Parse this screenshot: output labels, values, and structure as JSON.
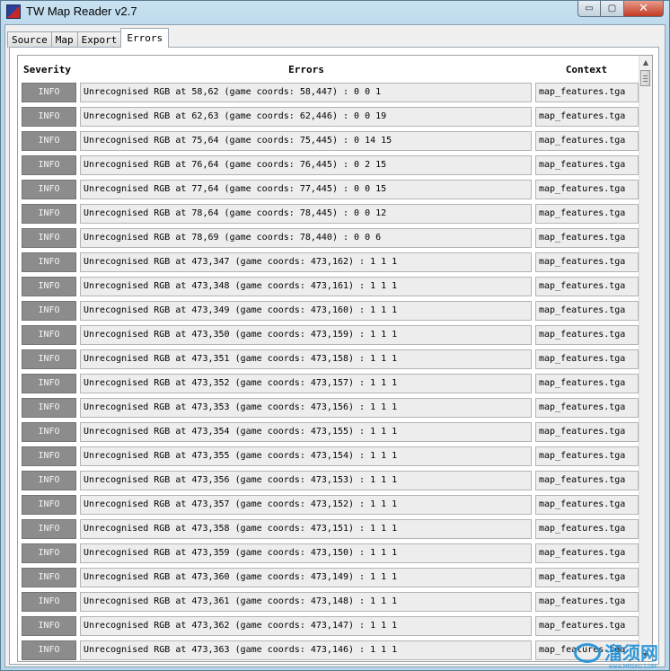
{
  "window": {
    "title": "TW Map Reader v2.7",
    "min_glyph": "▭",
    "max_glyph": "▢",
    "close_glyph": "✕"
  },
  "tabs": [
    {
      "label": "Source"
    },
    {
      "label": "Map"
    },
    {
      "label": "Export"
    },
    {
      "label": "Errors",
      "active": true
    }
  ],
  "table": {
    "headers": {
      "severity": "Severity",
      "errors": "Errors",
      "context": "Context"
    },
    "rows": [
      {
        "severity": "INFO",
        "message": "Unrecognised RGB at 58,62 (game coords: 58,447) : 0 0 1",
        "context": "map_features.tga"
      },
      {
        "severity": "INFO",
        "message": "Unrecognised RGB at 62,63 (game coords: 62,446) : 0 0 19",
        "context": "map_features.tga"
      },
      {
        "severity": "INFO",
        "message": "Unrecognised RGB at 75,64 (game coords: 75,445) : 0 14 15",
        "context": "map_features.tga"
      },
      {
        "severity": "INFO",
        "message": "Unrecognised RGB at 76,64 (game coords: 76,445) : 0 2 15",
        "context": "map_features.tga"
      },
      {
        "severity": "INFO",
        "message": "Unrecognised RGB at 77,64 (game coords: 77,445) : 0 0 15",
        "context": "map_features.tga"
      },
      {
        "severity": "INFO",
        "message": "Unrecognised RGB at 78,64 (game coords: 78,445) : 0 0 12",
        "context": "map_features.tga"
      },
      {
        "severity": "INFO",
        "message": "Unrecognised RGB at 78,69 (game coords: 78,440) : 0 0 6",
        "context": "map_features.tga"
      },
      {
        "severity": "INFO",
        "message": "Unrecognised RGB at 473,347 (game coords: 473,162) : 1 1 1",
        "context": "map_features.tga"
      },
      {
        "severity": "INFO",
        "message": "Unrecognised RGB at 473,348 (game coords: 473,161) : 1 1 1",
        "context": "map_features.tga"
      },
      {
        "severity": "INFO",
        "message": "Unrecognised RGB at 473,349 (game coords: 473,160) : 1 1 1",
        "context": "map_features.tga"
      },
      {
        "severity": "INFO",
        "message": "Unrecognised RGB at 473,350 (game coords: 473,159) : 1 1 1",
        "context": "map_features.tga"
      },
      {
        "severity": "INFO",
        "message": "Unrecognised RGB at 473,351 (game coords: 473,158) : 1 1 1",
        "context": "map_features.tga"
      },
      {
        "severity": "INFO",
        "message": "Unrecognised RGB at 473,352 (game coords: 473,157) : 1 1 1",
        "context": "map_features.tga"
      },
      {
        "severity": "INFO",
        "message": "Unrecognised RGB at 473,353 (game coords: 473,156) : 1 1 1",
        "context": "map_features.tga"
      },
      {
        "severity": "INFO",
        "message": "Unrecognised RGB at 473,354 (game coords: 473,155) : 1 1 1",
        "context": "map_features.tga"
      },
      {
        "severity": "INFO",
        "message": "Unrecognised RGB at 473,355 (game coords: 473,154) : 1 1 1",
        "context": "map_features.tga"
      },
      {
        "severity": "INFO",
        "message": "Unrecognised RGB at 473,356 (game coords: 473,153) : 1 1 1",
        "context": "map_features.tga"
      },
      {
        "severity": "INFO",
        "message": "Unrecognised RGB at 473,357 (game coords: 473,152) : 1 1 1",
        "context": "map_features.tga"
      },
      {
        "severity": "INFO",
        "message": "Unrecognised RGB at 473,358 (game coords: 473,151) : 1 1 1",
        "context": "map_features.tga"
      },
      {
        "severity": "INFO",
        "message": "Unrecognised RGB at 473,359 (game coords: 473,150) : 1 1 1",
        "context": "map_features.tga"
      },
      {
        "severity": "INFO",
        "message": "Unrecognised RGB at 473,360 (game coords: 473,149) : 1 1 1",
        "context": "map_features.tga"
      },
      {
        "severity": "INFO",
        "message": "Unrecognised RGB at 473,361 (game coords: 473,148) : 1 1 1",
        "context": "map_features.tga"
      },
      {
        "severity": "INFO",
        "message": "Unrecognised RGB at 473,362 (game coords: 473,147) : 1 1 1",
        "context": "map_features.tga"
      },
      {
        "severity": "INFO",
        "message": "Unrecognised RGB at 473,363 (game coords: 473,146) : 1 1 1",
        "context": "map_features.tga"
      }
    ]
  },
  "scrollbar": {
    "up_glyph": "▲",
    "down_glyph": "▼"
  },
  "watermark": {
    "text": "溜须网",
    "sub": "www.MRSKU.COM"
  },
  "colors": {
    "severity_badge": "#8c8c8c",
    "cell_background": "#ededed",
    "close_button": "#c23a23"
  }
}
